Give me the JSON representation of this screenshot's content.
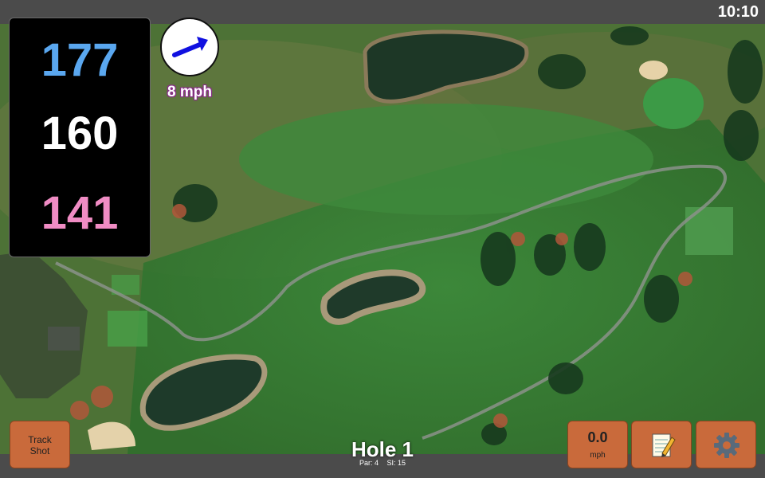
{
  "status_bar": {
    "time": "10:10"
  },
  "distances": {
    "back": "177",
    "middle": "160",
    "front": "141",
    "colors": {
      "back": "#5aa7ef",
      "middle": "#ffffff",
      "front": "#f08cc4"
    }
  },
  "wind": {
    "speed": "8 mph",
    "arrow_color": "#1010e0",
    "icon": "wind-direction-arrow"
  },
  "buttons": {
    "track_shot": {
      "line1": "Track",
      "line2": "Shot"
    },
    "speed": {
      "value": "0.0",
      "unit": "mph"
    },
    "notes_icon": "notepad-pencil-icon",
    "settings_icon": "gear-icon",
    "accent": "#c96a3b"
  },
  "hole": {
    "title": "Hole 1",
    "par": "Par: 4",
    "si": "SI: 15"
  }
}
